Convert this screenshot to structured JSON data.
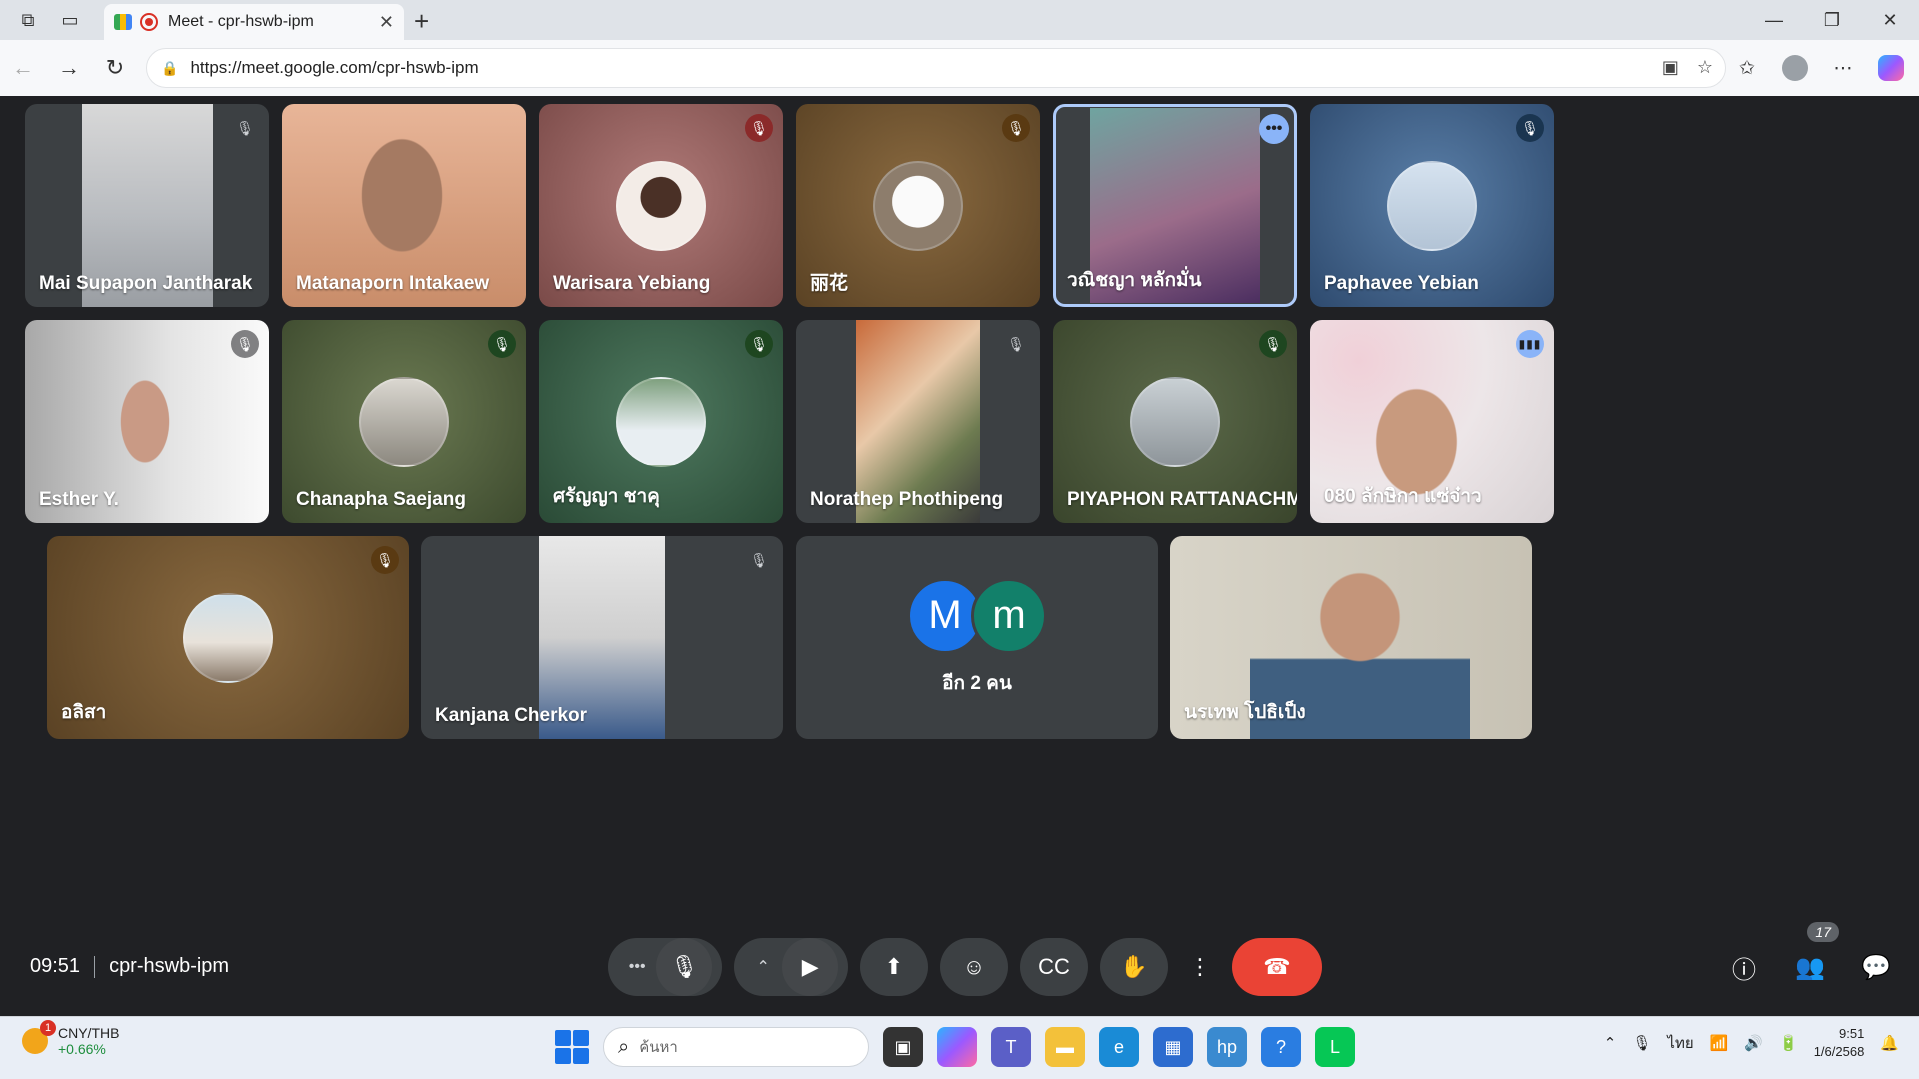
{
  "browser": {
    "tab_title": "Meet - cpr-hswb-ipm",
    "url": "https://meet.google.com/cpr-hswb-ipm"
  },
  "participants": [
    {
      "name": "Mai Supapon Jantharak"
    },
    {
      "name": "Matanaporn Intakaew"
    },
    {
      "name": "Warisara Yebiang"
    },
    {
      "name": "丽花"
    },
    {
      "name": "วณิชญา หลักมั่น"
    },
    {
      "name": "Paphavee Yebian"
    },
    {
      "name": "Esther Y."
    },
    {
      "name": "Chanapha Saejang"
    },
    {
      "name": "ศรัญญา ชาคุ"
    },
    {
      "name": "Norathep Phothipeng"
    },
    {
      "name": "PIYAPHON RATTANACHM..."
    },
    {
      "name": "080 ลักษิกา แซ่จ๋าว"
    },
    {
      "name": "อลิสา"
    },
    {
      "name": "Kanjana Cherkor"
    },
    {
      "name": "นรเทพ โปธิเป็ง"
    }
  ],
  "others_tile": {
    "initial_1": "M",
    "initial_2": "m",
    "label": "อีก 2 คน"
  },
  "meeting": {
    "time": "09:51",
    "code": "cpr-hswb-ipm",
    "participant_count": "17"
  },
  "taskbar": {
    "ticker": "CNY/THB",
    "ticker_change": "+0.66%",
    "search_placeholder": "ค้นหา",
    "lang": "ไทย",
    "time": "9:51",
    "date": "1/6/2568",
    "weather_badge": "1"
  },
  "colors": {
    "meet_bg": "#202124",
    "end_call": "#ea4335",
    "accent_blue": "#8ab4f8"
  }
}
